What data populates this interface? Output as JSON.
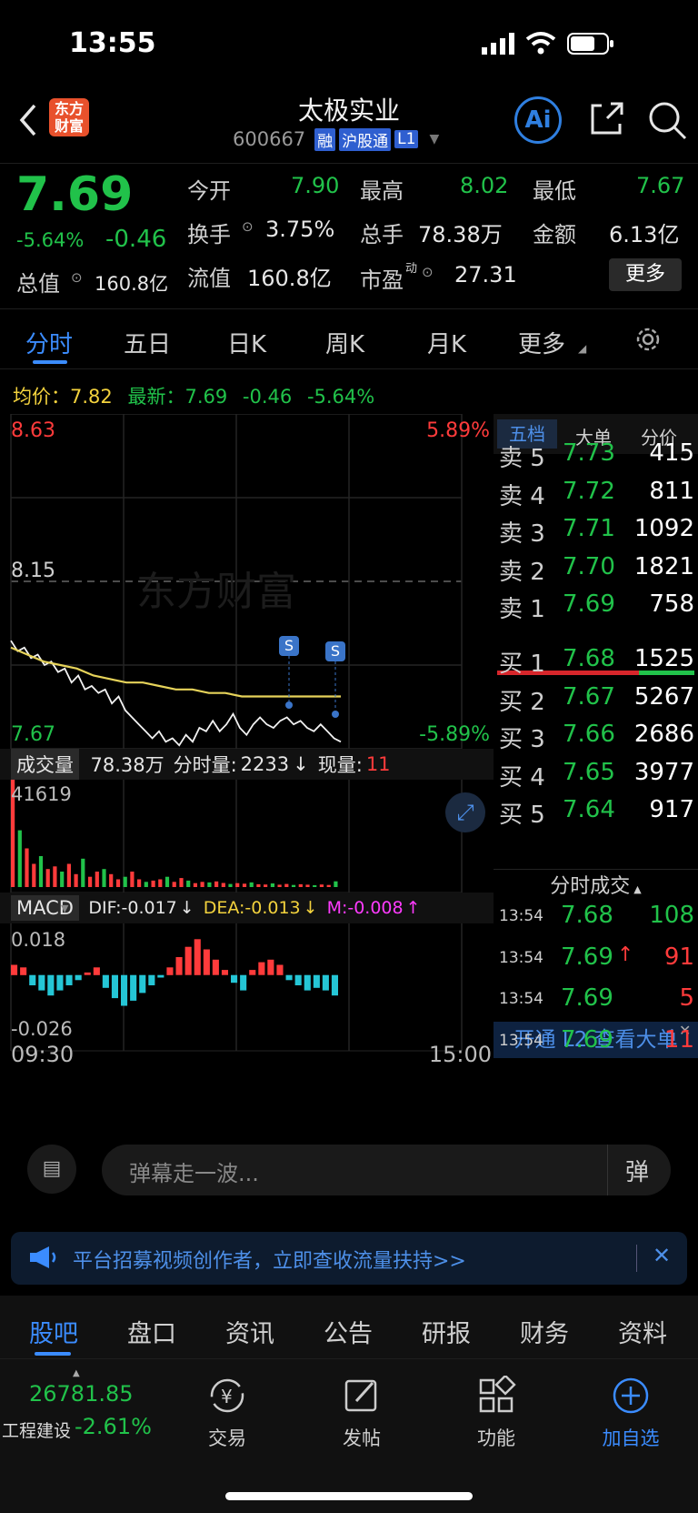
{
  "status_bar": {
    "time": "13:55"
  },
  "header": {
    "back_icon": "chevron-left-icon",
    "logo_text": "东方\n财富",
    "stock_name": "太极实业",
    "stock_code": "600667",
    "badges": [
      "融",
      "沪股通",
      "L1"
    ],
    "ai_label": "Ai"
  },
  "quote": {
    "price": "7.69",
    "change_pct": "-5.64%",
    "change": "-0.46",
    "open_label": "今开",
    "open": "7.90",
    "high_label": "最高",
    "high": "8.02",
    "low_label": "最低",
    "low": "7.67",
    "turnover_label": "换手",
    "turnover": "3.75%",
    "volume_label": "总手",
    "volume": "78.38万",
    "amount_label": "金额",
    "amount": "6.13亿",
    "total_value_label": "总值",
    "total_value": "160.8亿",
    "float_value_label": "流值",
    "float_value": "160.8亿",
    "pe_label": "市盈",
    "pe_sup": "动",
    "pe": "27.31",
    "more_button": "更多"
  },
  "chart_tabs": [
    "分时",
    "五日",
    "日K",
    "周K",
    "月K",
    "更多"
  ],
  "avg_bar": {
    "avg_label": "均价：",
    "avg": "7.82",
    "latest_label": "最新：",
    "latest": "7.69",
    "change": "-0.46",
    "change_pct": "-5.64%"
  },
  "intraday": {
    "y_top": "8.63",
    "y_mid": "8.15",
    "y_bottom": "7.67",
    "pct_top": "5.89%",
    "pct_bottom": "-5.89%",
    "watermark": "东方财富",
    "marker_label": "S"
  },
  "volume_panel": {
    "selector": "成交量",
    "total": "78.38万",
    "minute_label": "分时量:",
    "minute": "2233",
    "current_label": "现量:",
    "current": "11",
    "y_max": "41619"
  },
  "macd_panel": {
    "selector": "MACD",
    "dif": "DIF:-0.017",
    "dea": "DEA:-0.013",
    "m": "M:-0.008",
    "y_top": "0.018",
    "y_bottom": "-0.026",
    "time_start": "09:30",
    "time_end": "15:00"
  },
  "orderbook": {
    "tabs": [
      "五档",
      "大单",
      "分价"
    ],
    "asks": [
      {
        "label": "卖 5",
        "price": "7.73",
        "vol": "415"
      },
      {
        "label": "卖 4",
        "price": "7.72",
        "vol": "811"
      },
      {
        "label": "卖 3",
        "price": "7.71",
        "vol": "1092"
      },
      {
        "label": "卖 2",
        "price": "7.70",
        "vol": "1821"
      },
      {
        "label": "卖 1",
        "price": "7.69",
        "vol": "758"
      }
    ],
    "bids": [
      {
        "label": "买 1",
        "price": "7.68",
        "vol": "1525"
      },
      {
        "label": "买 2",
        "price": "7.67",
        "vol": "5267"
      },
      {
        "label": "买 3",
        "price": "7.66",
        "vol": "2686"
      },
      {
        "label": "买 4",
        "price": "7.65",
        "vol": "3977"
      },
      {
        "label": "买 5",
        "price": "7.64",
        "vol": "917"
      }
    ],
    "ticks_title": "分时成交",
    "ticks": [
      {
        "time": "13:54",
        "price": "7.68",
        "vol": "108",
        "arrow": ""
      },
      {
        "time": "13:54",
        "price": "7.69",
        "vol": "91",
        "arrow": "↑"
      },
      {
        "time": "13:54",
        "price": "7.69",
        "vol": "5",
        "arrow": ""
      },
      {
        "time": "13:54",
        "price": "7.69",
        "vol": "11",
        "arrow": ""
      }
    ],
    "l2_banner": "开通 L2 查看大单"
  },
  "danmu": {
    "placeholder": "弹幕走一波...",
    "toggle_label": "弹"
  },
  "banner": {
    "text": "平台招募视频创作者，立即查收流量扶持>>"
  },
  "sub_tabs": [
    "股吧",
    "盘口",
    "资讯",
    "公告",
    "研报",
    "财务",
    "资料"
  ],
  "bottom_nav": {
    "index_value": "26781.85",
    "index_name": "工程建设",
    "index_change": "-2.61%",
    "items": [
      "交易",
      "发帖",
      "功能",
      "加自选"
    ]
  },
  "colors": {
    "up": "#ff3b3b",
    "down": "#21c24a",
    "accent": "#2f7fe0",
    "avg_line": "#e6d35a"
  },
  "chart_data": [
    {
      "type": "line",
      "title": "分时",
      "series": [
        {
          "name": "最新",
          "values": [
            7.98,
            7.95,
            7.96,
            7.93,
            7.94,
            7.91,
            7.92,
            7.89,
            7.9,
            7.86,
            7.88,
            7.84,
            7.85,
            7.83,
            7.84,
            7.8,
            7.82,
            7.78,
            7.76,
            7.74,
            7.72,
            7.7,
            7.72,
            7.69,
            7.7,
            7.68,
            7.71,
            7.69,
            7.73,
            7.72,
            7.75,
            7.72,
            7.74,
            7.77,
            7.73,
            7.71,
            7.74,
            7.76,
            7.74,
            7.73,
            7.75,
            7.76,
            7.74,
            7.75,
            7.73,
            7.72,
            7.74,
            7.72,
            7.7,
            7.69
          ]
        },
        {
          "name": "均价",
          "values": [
            7.96,
            7.94,
            7.92,
            7.91,
            7.9,
            7.88,
            7.87,
            7.86,
            7.86,
            7.85,
            7.84,
            7.84,
            7.83,
            7.83,
            7.82,
            7.82,
            7.82,
            7.82,
            7.82,
            7.82,
            7.82
          ]
        }
      ],
      "ylim": [
        7.67,
        8.63
      ]
    },
    {
      "type": "bar",
      "title": "成交量",
      "values": [
        41619,
        22000,
        15000,
        9000,
        12000,
        7000,
        8000,
        6000,
        9000,
        5000,
        11000,
        4000,
        6000,
        7000,
        5000,
        3000,
        4000,
        6000,
        3000,
        2000,
        2500,
        3000,
        4000,
        2000,
        3500,
        2500,
        1500,
        2000,
        1800,
        2200,
        1600,
        1200,
        1500,
        1300,
        1800,
        1100,
        1000,
        1400,
        900,
        1200,
        800,
        1100,
        900,
        700,
        1000,
        800,
        2233
      ],
      "ylim": [
        0,
        41619
      ]
    },
    {
      "type": "bar",
      "title": "MACD",
      "values": [
        0.004,
        0.003,
        -0.004,
        -0.006,
        -0.008,
        -0.006,
        -0.004,
        -0.002,
        0.001,
        0.003,
        -0.005,
        -0.009,
        -0.012,
        -0.01,
        -0.007,
        -0.004,
        -0.001,
        0.003,
        0.007,
        0.011,
        0.014,
        0.01,
        0.006,
        0.002,
        -0.003,
        -0.006,
        0.002,
        0.005,
        0.006,
        0.004,
        -0.002,
        -0.004,
        -0.006,
        -0.005,
        -0.006,
        -0.008
      ],
      "ylim": [
        -0.026,
        0.018
      ]
    }
  ]
}
